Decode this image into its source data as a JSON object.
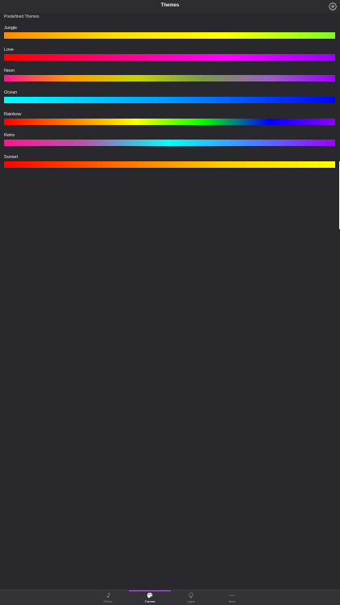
{
  "header": {
    "title": "Themes",
    "add_icon": "plus-circle-icon"
  },
  "section": {
    "title": "Predefined Themes"
  },
  "themes": [
    {
      "name": "Jungle",
      "colors": [
        "#ff8a00",
        "#ffdd00",
        "#ffff00",
        "#7cfc1e"
      ]
    },
    {
      "name": "Love",
      "colors": [
        "#ff0000",
        "#ff0080",
        "#ff00ff",
        "#9b00ff"
      ]
    },
    {
      "name": "Neon",
      "colors": [
        "#ff1493",
        "#ff9a00",
        "#c8d400",
        "#7a9a48",
        "#9a60c0",
        "#9b00ff"
      ]
    },
    {
      "name": "Ocean",
      "colors": [
        "#00ffff",
        "#0099ff",
        "#0000ff"
      ]
    },
    {
      "name": "Rainbow",
      "colors": [
        "#ff0000",
        "#ff8000",
        "#ffff00",
        "#00ff00",
        "#0000ff",
        "#8b00ff"
      ]
    },
    {
      "name": "Retro",
      "colors": [
        "#ff1493",
        "#b05aa8",
        "#00ffff",
        "#4a80ff",
        "#9b00ff"
      ]
    },
    {
      "name": "Sunset",
      "colors": [
        "#ff0000",
        "#ff6a00",
        "#ffcc00",
        "#ffff00"
      ]
    }
  ],
  "tabs": [
    {
      "label": "Effects",
      "icon": "music-note-icon",
      "active": false
    },
    {
      "label": "Themes",
      "icon": "palette-icon",
      "active": true
    },
    {
      "label": "Lights",
      "icon": "lightbulb-icon",
      "active": false
    },
    {
      "label": "More",
      "icon": "more-dots-icon",
      "active": false
    }
  ],
  "colors": {
    "accent": "#b05ad8",
    "background": "#29282d"
  }
}
